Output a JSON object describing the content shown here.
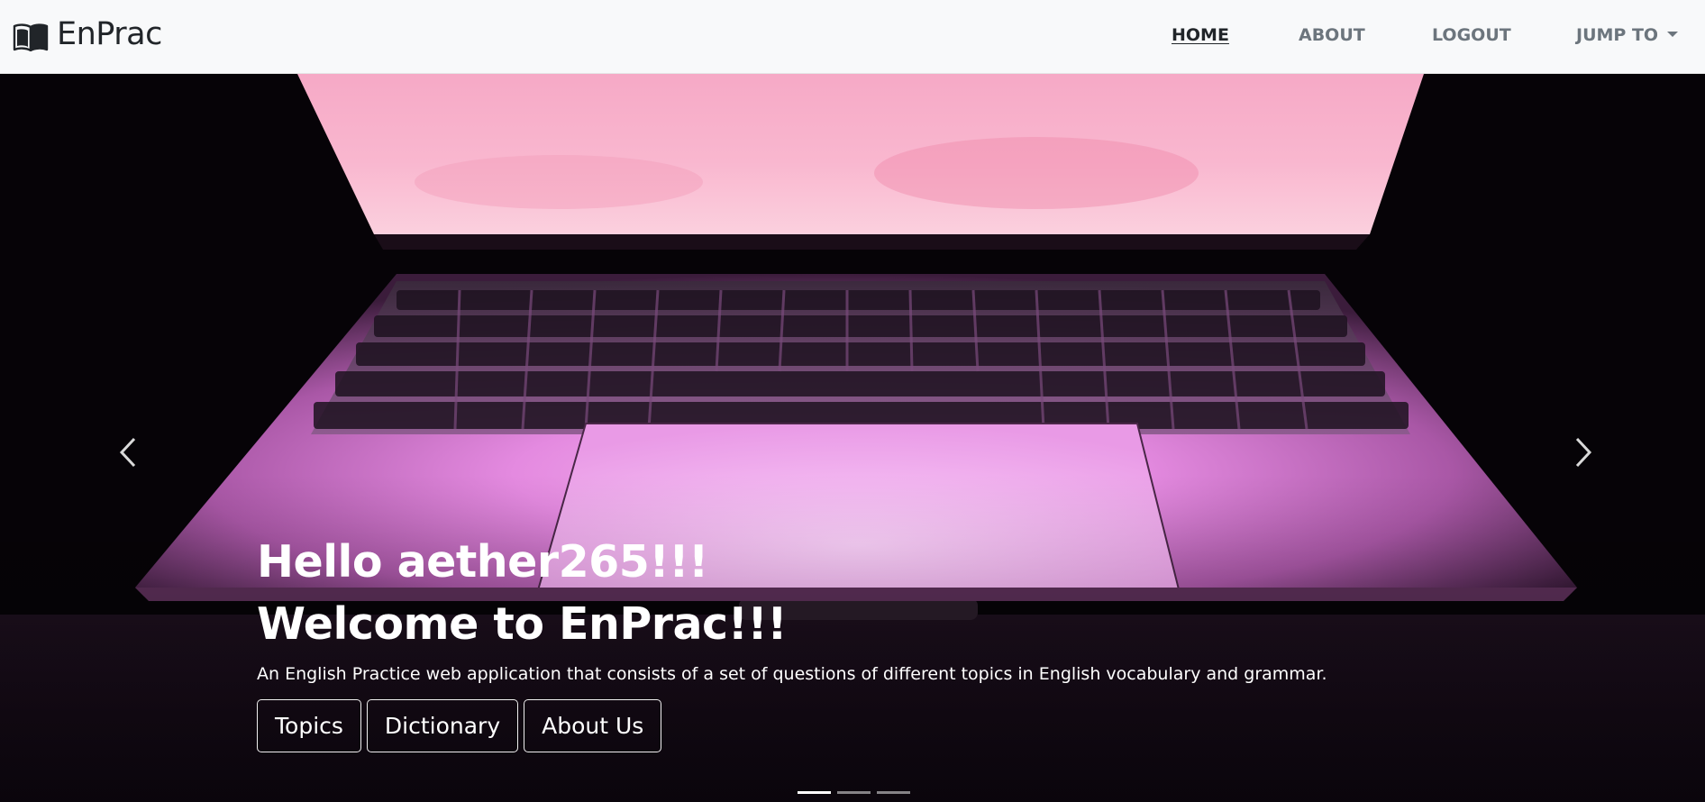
{
  "navbar": {
    "brand": "EnPrac",
    "brand_icon": "book-icon",
    "links": [
      {
        "label": "HOME",
        "active": true
      },
      {
        "label": "ABOUT",
        "active": false
      },
      {
        "label": "LOGOUT",
        "active": false
      },
      {
        "label": "JUMP TO",
        "active": false,
        "dropdown": true
      }
    ]
  },
  "hero": {
    "greeting_prefix": "Hello ",
    "username": "aether265",
    "greeting_suffix": "!!!",
    "welcome": "Welcome to EnPrac!!!",
    "description": "An English Practice web application that consists of a set of questions of different topics in English vocabulary and grammar.",
    "buttons": [
      "Topics",
      "Dictionary",
      "About Us"
    ],
    "prev_icon": "chevron-left-icon",
    "next_icon": "chevron-right-icon",
    "slides_count": 3,
    "active_slide": 1
  },
  "colors": {
    "navbar_bg": "#f8f9fa",
    "text_dark": "#212529",
    "text_muted": "#6c757d",
    "screen_pink": "#f7a8c4",
    "laptop_body": "#c870c4"
  }
}
